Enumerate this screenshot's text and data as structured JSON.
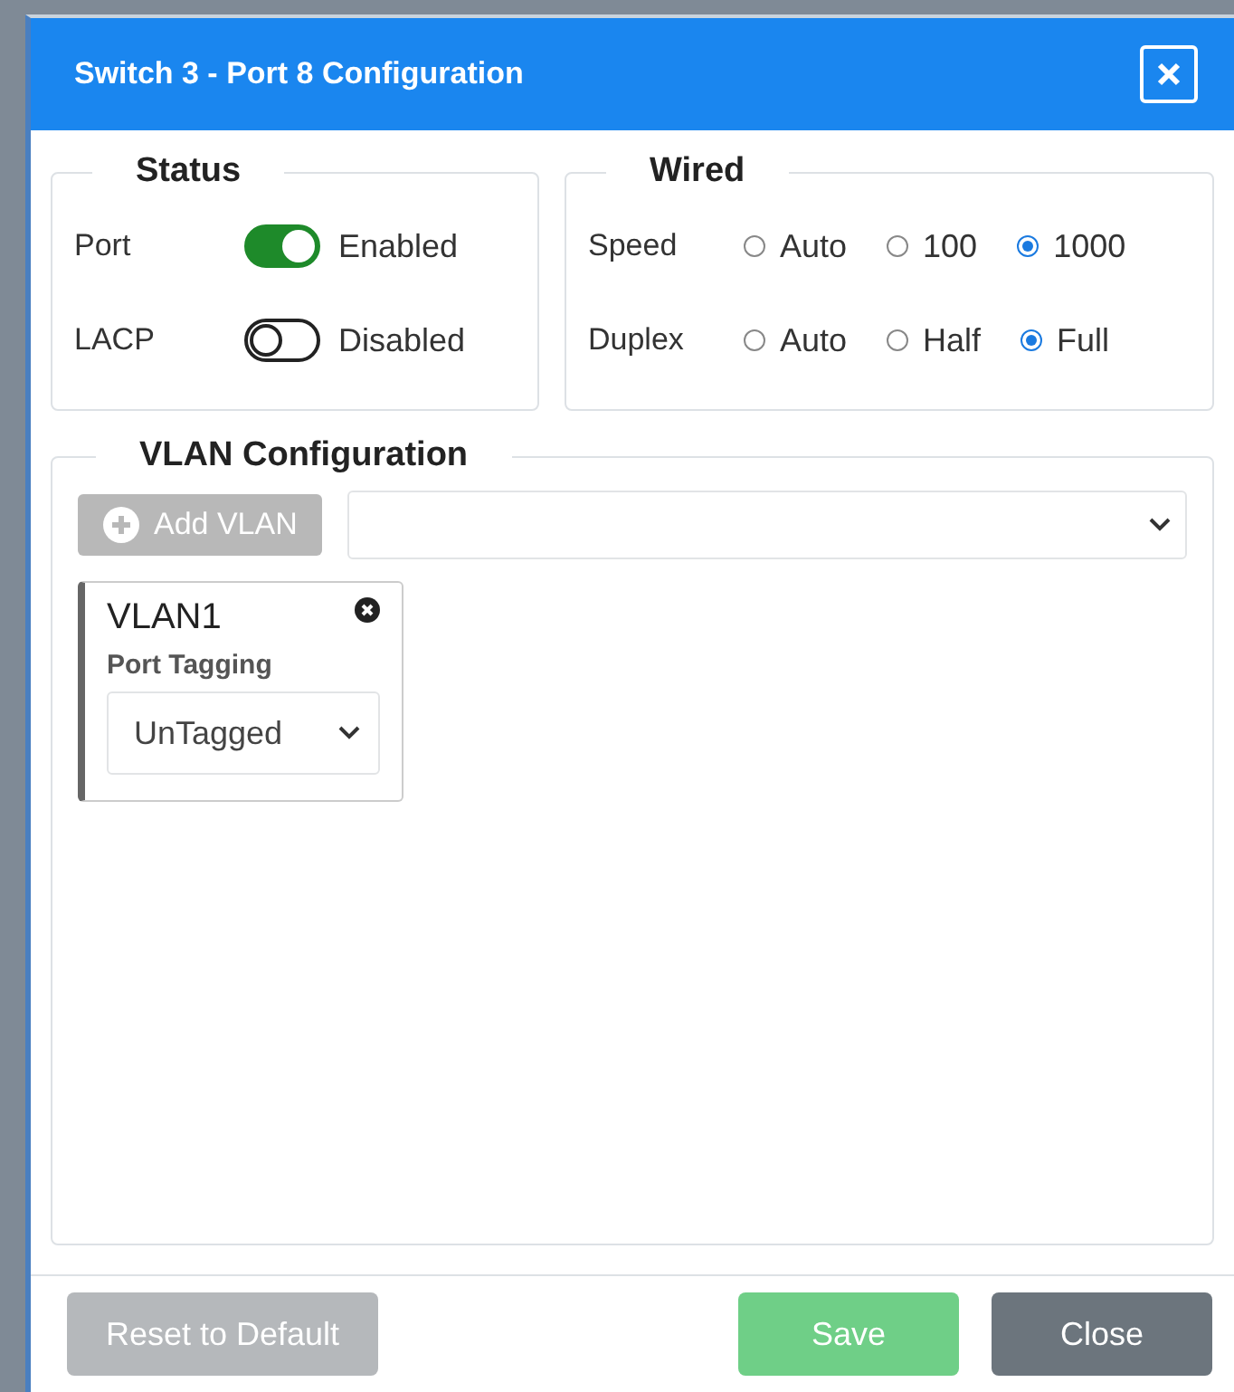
{
  "window": {
    "title": "Switch 3 - Port 8 Configuration"
  },
  "status": {
    "title": "Status",
    "toggles": [
      {
        "label": "Port",
        "on": true,
        "state_text": "Enabled"
      },
      {
        "label": "LACP",
        "on": false,
        "state_text": "Disabled"
      }
    ]
  },
  "wired": {
    "title": "Wired",
    "groups": [
      {
        "label": "Speed",
        "options": [
          {
            "label": "Auto",
            "selected": false
          },
          {
            "label": "100",
            "selected": false
          },
          {
            "label": "1000",
            "selected": true
          }
        ]
      },
      {
        "label": "Duplex",
        "options": [
          {
            "label": "Auto",
            "selected": false
          },
          {
            "label": "Half",
            "selected": false
          },
          {
            "label": "Full",
            "selected": true
          }
        ]
      }
    ]
  },
  "vlan_configuration": {
    "title": "VLAN Configuration",
    "add_button": {
      "label": "Add VLAN",
      "disabled": true
    },
    "vlans": [
      {
        "name": "VLAN1",
        "field_label": "Port Tagging",
        "value": "UnTagged"
      }
    ]
  },
  "footer": {
    "buttons": [
      {
        "label": "Reset to Default",
        "kind": "reset",
        "disabled": true
      },
      {
        "label": "Save",
        "kind": "save",
        "disabled": true
      },
      {
        "label": "Close",
        "kind": "close",
        "disabled": false
      }
    ]
  }
}
